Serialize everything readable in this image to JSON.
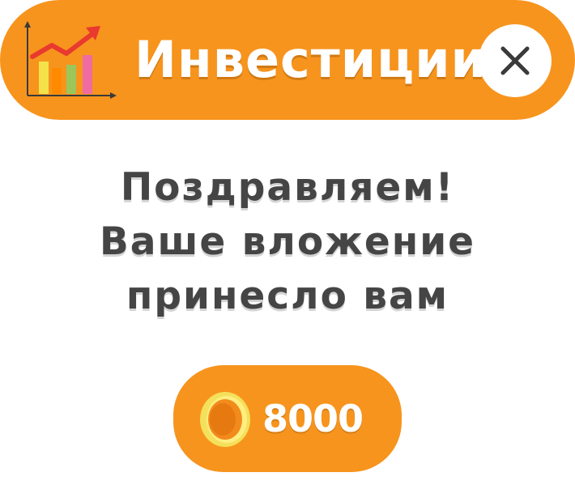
{
  "header": {
    "title": "Инвестиции",
    "icon": "growth-chart-icon",
    "close_icon": "close-icon"
  },
  "message": {
    "lines": [
      "Поздравляем!",
      "Ваше вложение",
      "принесло вам"
    ]
  },
  "reward": {
    "amount": "8000",
    "icon": "coin-icon"
  },
  "colors": {
    "accent": "#F7941D",
    "text_dark": "#454545",
    "white": "#FFFFFF",
    "coin_yellow": "#F4E05A",
    "coin_orange": "#F28B1C"
  }
}
